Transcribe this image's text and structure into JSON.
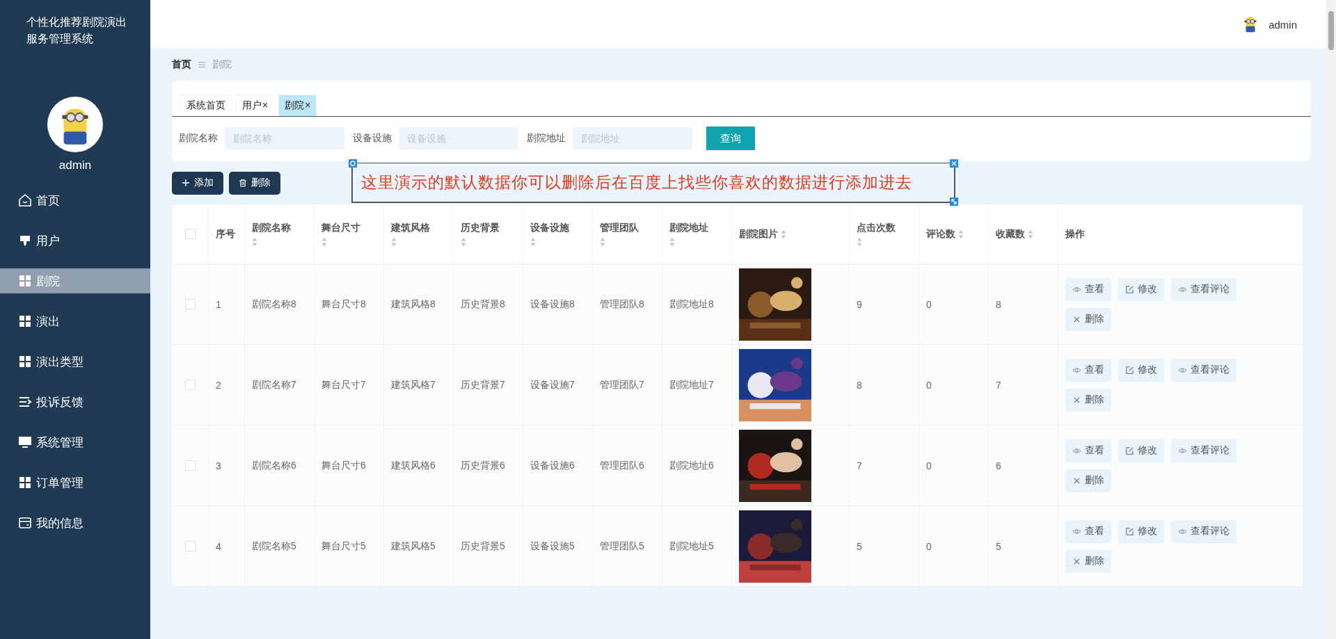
{
  "sidebar": {
    "title": "个性化推荐剧院演出服务管理系统",
    "username": "admin",
    "items": [
      {
        "label": "首页",
        "selected": false
      },
      {
        "label": "用户",
        "selected": false
      },
      {
        "label": "剧院",
        "selected": true
      },
      {
        "label": "演出",
        "selected": false
      },
      {
        "label": "演出类型",
        "selected": false
      },
      {
        "label": "投诉反馈",
        "selected": false
      },
      {
        "label": "系统管理",
        "selected": false
      },
      {
        "label": "订单管理",
        "selected": false
      },
      {
        "label": "我的信息",
        "selected": false
      }
    ]
  },
  "header": {
    "username": "admin"
  },
  "breadcrumb": [
    "首页",
    "剧院"
  ],
  "tabs": [
    {
      "label": "系统首页",
      "closable": false,
      "selected": false
    },
    {
      "label": "用户",
      "closable": true,
      "selected": false
    },
    {
      "label": "剧院",
      "closable": true,
      "selected": true
    }
  ],
  "close_mark": "×",
  "filters": [
    {
      "label": "剧院名称",
      "placeholder": "剧院名称"
    },
    {
      "label": "设备设施",
      "placeholder": "设备设施"
    },
    {
      "label": "剧院地址",
      "placeholder": "剧院地址"
    }
  ],
  "search_button": "查询",
  "actions": [
    {
      "kind": "add",
      "label": "添加"
    },
    {
      "kind": "delete",
      "label": "删除"
    }
  ],
  "note": "这里演示的默认数据你可以删除后在百度上找些你喜欢的数据进行添加进去",
  "table": {
    "select_all": {
      "checked": false
    },
    "columns": [
      {
        "label": "序号",
        "sortable": false
      },
      {
        "label": "剧院名称",
        "sortable": true
      },
      {
        "label": "舞台尺寸",
        "sortable": true
      },
      {
        "label": "建筑风格",
        "sortable": true
      },
      {
        "label": "历史背景",
        "sortable": true
      },
      {
        "label": "设备设施",
        "sortable": true
      },
      {
        "label": "管理团队",
        "sortable": true
      },
      {
        "label": "剧院地址",
        "sortable": true
      },
      {
        "label": "剧院图片",
        "sortable": true
      },
      {
        "label": "点击次数",
        "sortable": true
      },
      {
        "label": "评论数",
        "sortable": true
      },
      {
        "label": "收藏数",
        "sortable": true
      },
      {
        "label": "操作",
        "sortable": false
      }
    ],
    "rows": [
      {
        "checked": false,
        "cells": [
          "1",
          "剧院名称8",
          "舞台尺寸8",
          "建筑风格8",
          "历史背景8",
          "设备设施8",
          "管理团队8",
          "剧院地址8"
        ],
        "stats": [
          "9",
          "0",
          "8"
        ],
        "actions": [
          {
            "kind": "view",
            "label": "查看"
          },
          {
            "kind": "edit",
            "label": "修改"
          },
          {
            "kind": "view",
            "label": "查看评论"
          },
          {
            "kind": "delete",
            "label": "删除"
          }
        ]
      },
      {
        "checked": false,
        "cells": [
          "2",
          "剧院名称7",
          "舞台尺寸7",
          "建筑风格7",
          "历史背景7",
          "设备设施7",
          "管理团队7",
          "剧院地址7"
        ],
        "stats": [
          "8",
          "0",
          "7"
        ],
        "actions": [
          {
            "kind": "view",
            "label": "查看"
          },
          {
            "kind": "edit",
            "label": "修改"
          },
          {
            "kind": "view",
            "label": "查看评论"
          },
          {
            "kind": "delete",
            "label": "删除"
          }
        ]
      },
      {
        "checked": false,
        "cells": [
          "3",
          "剧院名称6",
          "舞台尺寸6",
          "建筑风格6",
          "历史背景6",
          "设备设施6",
          "管理团队6",
          "剧院地址6"
        ],
        "stats": [
          "7",
          "0",
          "6"
        ],
        "actions": [
          {
            "kind": "view",
            "label": "查看"
          },
          {
            "kind": "edit",
            "label": "修改"
          },
          {
            "kind": "view",
            "label": "查看评论"
          },
          {
            "kind": "delete",
            "label": "删除"
          }
        ]
      },
      {
        "checked": false,
        "cells": [
          "4",
          "剧院名称5",
          "舞台尺寸5",
          "建筑风格5",
          "历史背景5",
          "设备设施5",
          "管理团队5",
          "剧院地址5"
        ],
        "stats": [
          "5",
          "0",
          "5"
        ],
        "actions": [
          {
            "kind": "view",
            "label": "查看"
          },
          {
            "kind": "edit",
            "label": "修改"
          },
          {
            "kind": "view",
            "label": "查看评论"
          },
          {
            "kind": "delete",
            "label": "删除"
          }
        ]
      }
    ]
  }
}
